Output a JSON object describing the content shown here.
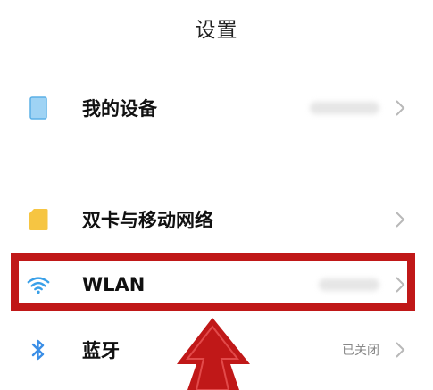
{
  "header": {
    "title": "设置"
  },
  "items": [
    {
      "label": "我的设备",
      "value": "",
      "icon": "device-icon",
      "icon_color": "#8ecbf0"
    },
    {
      "label": "双卡与移动网络",
      "value": "",
      "icon": "sim-card-icon",
      "icon_color": "#f6c542"
    },
    {
      "label": "WLAN",
      "value": "",
      "icon": "wifi-icon",
      "icon_color": "#3aa0e8"
    },
    {
      "label": "蓝牙",
      "value": "已关闭",
      "icon": "bluetooth-icon",
      "icon_color": "#3a8ee6"
    }
  ],
  "annotation": {
    "highlight_color": "#c01818",
    "arrow_color": "#c01818"
  }
}
